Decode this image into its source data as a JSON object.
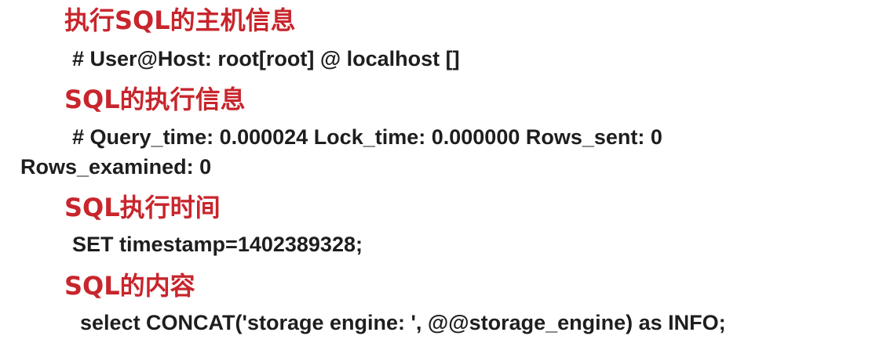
{
  "sections": [
    {
      "heading": "执行SQL的主机信息",
      "lines": [
        "# User@Host: root[root] @ localhost  []"
      ]
    },
    {
      "heading": "SQL的执行信息",
      "lines": [
        "# Query_time: 0.000024  Lock_time: 0.000000  Rows_sent: 0",
        "Rows_examined: 0"
      ]
    },
    {
      "heading": "SQL执行时间",
      "lines": [
        "SET timestamp=1402389328;"
      ]
    },
    {
      "heading": "SQL的内容",
      "lines": [
        "select CONCAT('storage engine: ', @@storage_engine) as INFO;"
      ]
    }
  ],
  "colors": {
    "heading": "#c8252c",
    "body": "#1e1e1e",
    "background": "#ffffff"
  }
}
